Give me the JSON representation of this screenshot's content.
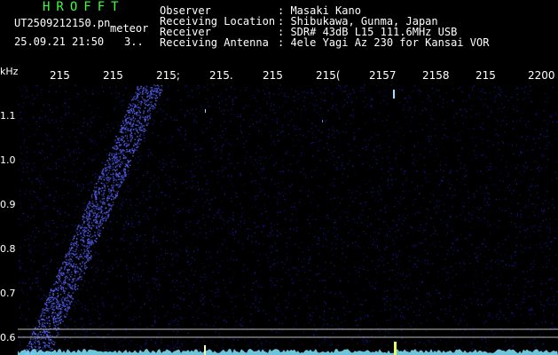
{
  "logo_text": "HROFFT",
  "file_name": "UT2509212150.pn",
  "meteor_label": "meteor",
  "datetime": "25.09.21 21:50",
  "count_text": "3..",
  "info": [
    {
      "label": "Observer",
      "value": ": Masaki Kano"
    },
    {
      "label": "Receiving Location",
      "value": ": Shibukawa, Gunma, Japan"
    },
    {
      "label": "Receiver",
      "value": ": SDR# 43dB L15 111.6MHz USB"
    },
    {
      "label": "Receiving Antenna",
      "value": ": 4ele Yagi Az 230 for Kansai VOR"
    }
  ],
  "y_axis": {
    "unit": "kHz",
    "ticks": [
      "1.1",
      "1.0",
      "0.9",
      "0.8",
      "0.7",
      "0.6"
    ]
  },
  "x_axis": {
    "ticks": [
      "215",
      "215",
      "215;",
      "215.",
      "215",
      "215(",
      "2157",
      "2158",
      "215",
      "2200"
    ]
  },
  "colors": {
    "background": "#000000",
    "noise_blue": "#1a1a8a",
    "signal_cyan": "#7fe8ff",
    "header_green": "#3cff3c",
    "grid_white": "#bbbbbb"
  }
}
